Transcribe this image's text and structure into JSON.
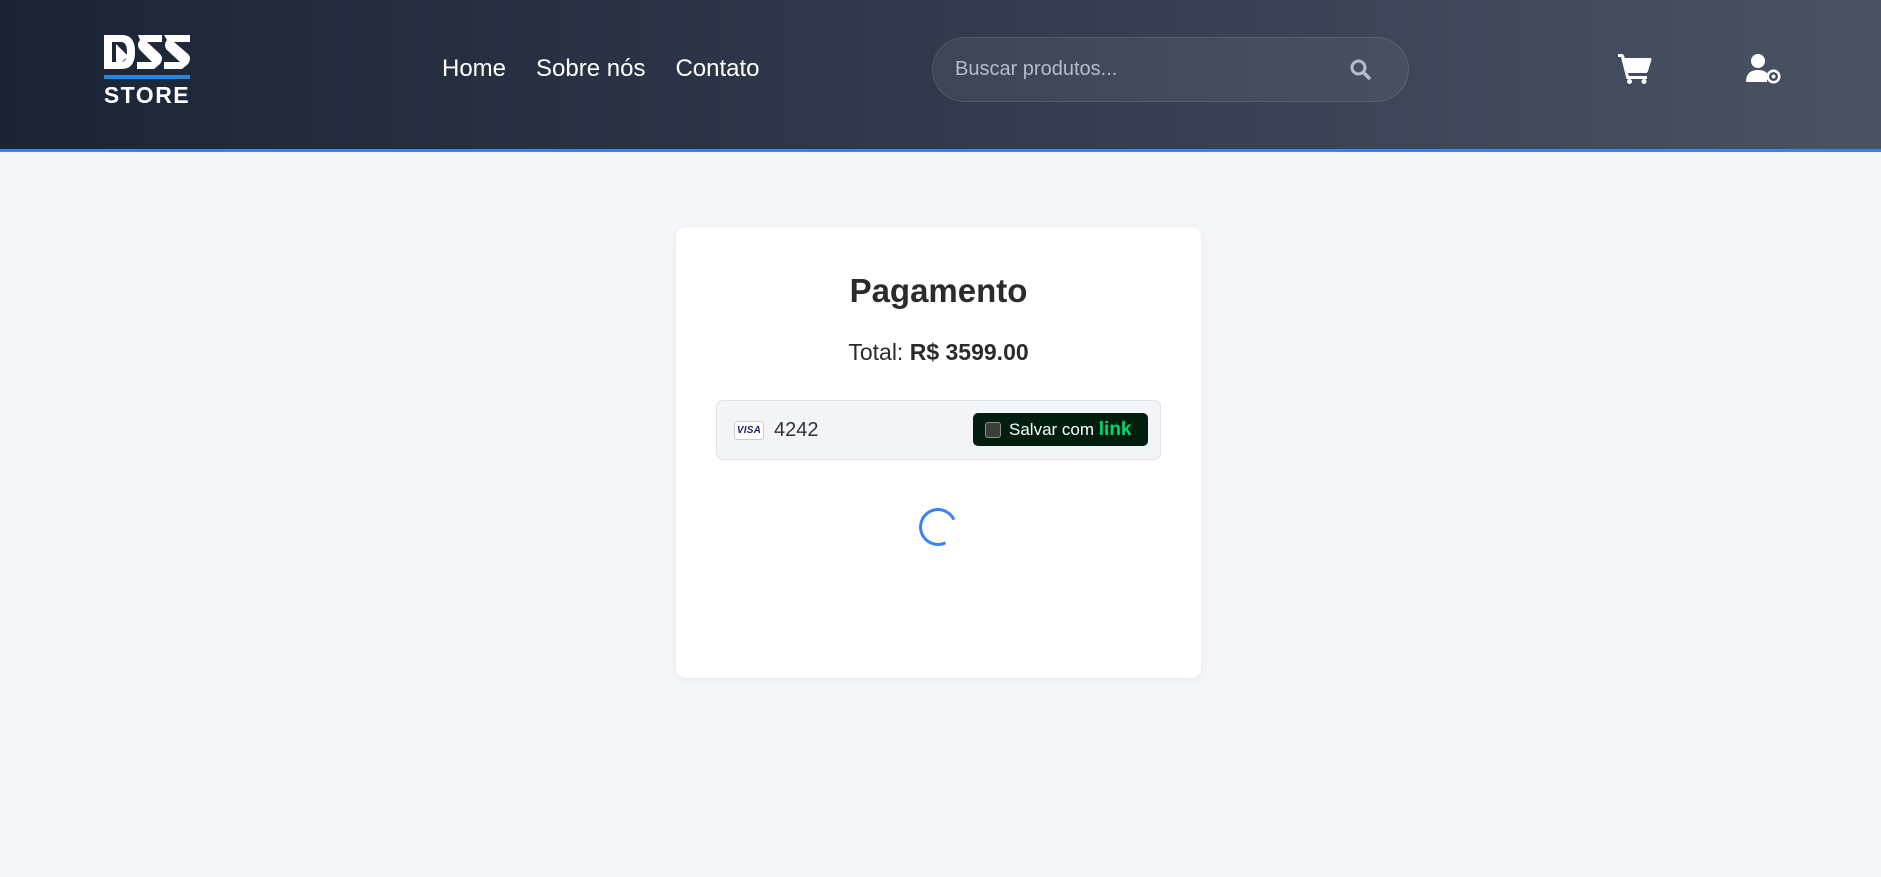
{
  "header": {
    "logo": {
      "text_top": "DSS",
      "text_bottom": "STORE"
    },
    "nav": [
      {
        "label": "Home"
      },
      {
        "label": "Sobre nós"
      },
      {
        "label": "Contato"
      }
    ],
    "search": {
      "placeholder": "Buscar produtos...",
      "value": "",
      "icon": "search-icon"
    },
    "cart_icon": "cart-icon",
    "user_icon": "user-settings-icon"
  },
  "payment": {
    "title": "Pagamento",
    "total_label": "Total:",
    "total_value": "R$ 3599.00",
    "card": {
      "brand": "VISA",
      "last4": "4242"
    },
    "link_button": {
      "label": "Salvar com",
      "brand": "link",
      "checked": false
    },
    "status": "loading"
  },
  "colors": {
    "accent": "#3b82f6",
    "link_bg": "#011e0f",
    "link_brand": "#00d66f"
  }
}
